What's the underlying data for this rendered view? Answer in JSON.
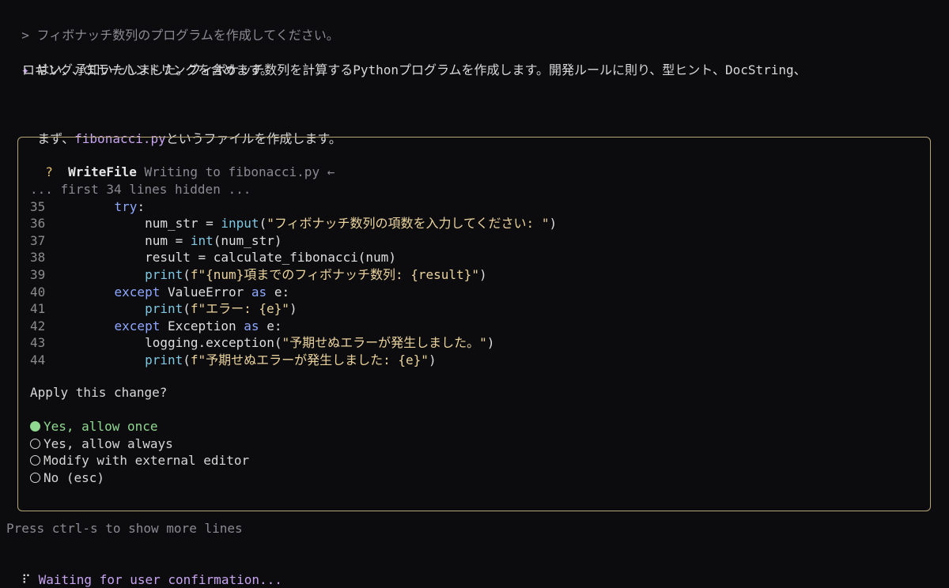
{
  "user_prompt": {
    "prefix": ">",
    "text": "フィボナッチ数列のプログラムを作成してください。"
  },
  "assistant": {
    "icon": "sparkle-icon",
    "line1": "はい、承知いたしました。フィボナッチ数列を計算するPythonプログラムを作成します。開発ルールに則り、型ヒント、DocString、",
    "line2": "ロギング、エラーハンドリングを含めます。",
    "line3_before": "まず、",
    "line3_file": "fibonacci.py",
    "line3_after": "というファイルを作成します。"
  },
  "tool_call": {
    "marker": "?",
    "name": "WriteFile",
    "description": "Writing to fibonacci.py ←",
    "hidden_notice": "... first 34 lines hidden ...",
    "code_lines": [
      {
        "num": "35",
        "indent": "    ",
        "parts": [
          {
            "t": "try",
            "c": "kw"
          },
          {
            "t": ":",
            "c": "var"
          }
        ]
      },
      {
        "num": "36",
        "indent": "        ",
        "parts": [
          {
            "t": "num_str = ",
            "c": "var"
          },
          {
            "t": "input",
            "c": "fn"
          },
          {
            "t": "(",
            "c": "var"
          },
          {
            "t": "\"フィボナッチ数列の項数を入力してください: \"",
            "c": "str"
          },
          {
            "t": ")",
            "c": "var"
          }
        ]
      },
      {
        "num": "37",
        "indent": "        ",
        "parts": [
          {
            "t": "num = ",
            "c": "var"
          },
          {
            "t": "int",
            "c": "fn"
          },
          {
            "t": "(num_str)",
            "c": "var"
          }
        ]
      },
      {
        "num": "38",
        "indent": "        ",
        "parts": [
          {
            "t": "result = calculate_fibonacci(num)",
            "c": "var"
          }
        ]
      },
      {
        "num": "39",
        "indent": "        ",
        "parts": [
          {
            "t": "print",
            "c": "fn"
          },
          {
            "t": "(",
            "c": "var"
          },
          {
            "t": "f\"{num}項までのフィボナッチ数列: {result}\"",
            "c": "str"
          },
          {
            "t": ")",
            "c": "var"
          }
        ]
      },
      {
        "num": "40",
        "indent": "    ",
        "parts": [
          {
            "t": "except",
            "c": "kw"
          },
          {
            "t": " ValueError ",
            "c": "var"
          },
          {
            "t": "as",
            "c": "kw"
          },
          {
            "t": " e:",
            "c": "var"
          }
        ]
      },
      {
        "num": "41",
        "indent": "        ",
        "parts": [
          {
            "t": "print",
            "c": "fn"
          },
          {
            "t": "(",
            "c": "var"
          },
          {
            "t": "f\"エラー: {e}\"",
            "c": "str"
          },
          {
            "t": ")",
            "c": "var"
          }
        ]
      },
      {
        "num": "42",
        "indent": "    ",
        "parts": [
          {
            "t": "except",
            "c": "kw"
          },
          {
            "t": " Exception ",
            "c": "var"
          },
          {
            "t": "as",
            "c": "kw"
          },
          {
            "t": " e:",
            "c": "var"
          }
        ]
      },
      {
        "num": "43",
        "indent": "        ",
        "parts": [
          {
            "t": "logging.exception(",
            "c": "var"
          },
          {
            "t": "\"予期せぬエラーが発生しました。\"",
            "c": "str"
          },
          {
            "t": ")",
            "c": "var"
          }
        ]
      },
      {
        "num": "44",
        "indent": "        ",
        "parts": [
          {
            "t": "print",
            "c": "fn"
          },
          {
            "t": "(",
            "c": "var"
          },
          {
            "t": "f\"予期せぬエラーが発生しました: {e}\"",
            "c": "str"
          },
          {
            "t": ")",
            "c": "var"
          }
        ]
      }
    ],
    "question": "Apply this change?",
    "options": [
      {
        "label": "Yes, allow once",
        "selected": true
      },
      {
        "label": "Yes, allow always",
        "selected": false
      },
      {
        "label": "Modify with external editor",
        "selected": false
      },
      {
        "label": "No (esc)",
        "selected": false
      }
    ]
  },
  "footer": {
    "hint": "Press ctrl-s to show more lines",
    "spinner": "⠏",
    "status": "Waiting for user confirmation..."
  },
  "colors": {
    "background": "#0c0c0e",
    "border": "#b8a57a",
    "accent_purple": "#c7a3f0",
    "keyword": "#8fa8ff",
    "function": "#7ec8e3",
    "string": "#ebd39e",
    "selected": "#8fd891"
  }
}
